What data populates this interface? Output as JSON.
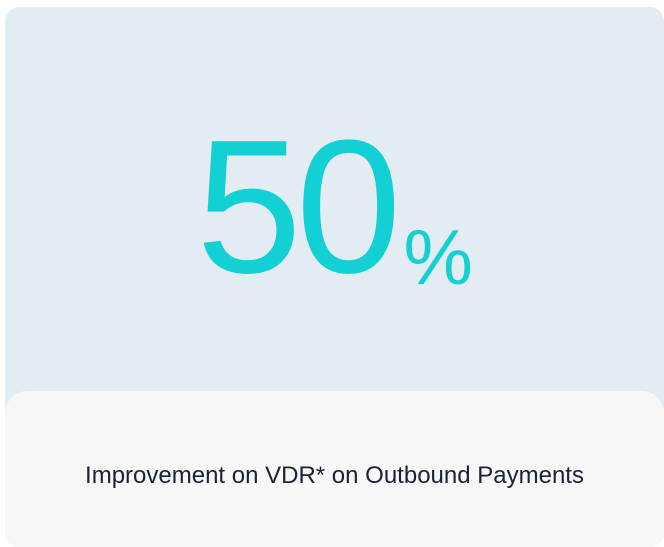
{
  "stat": {
    "value": "50",
    "unit": "%"
  },
  "caption": "Improvement on VDR* on Outbound Payments",
  "colors": {
    "accent": "#12d0d4",
    "card_top": "#e3ecf3",
    "card_bottom": "#f7f7f8",
    "caption_text": "#1a2238"
  }
}
